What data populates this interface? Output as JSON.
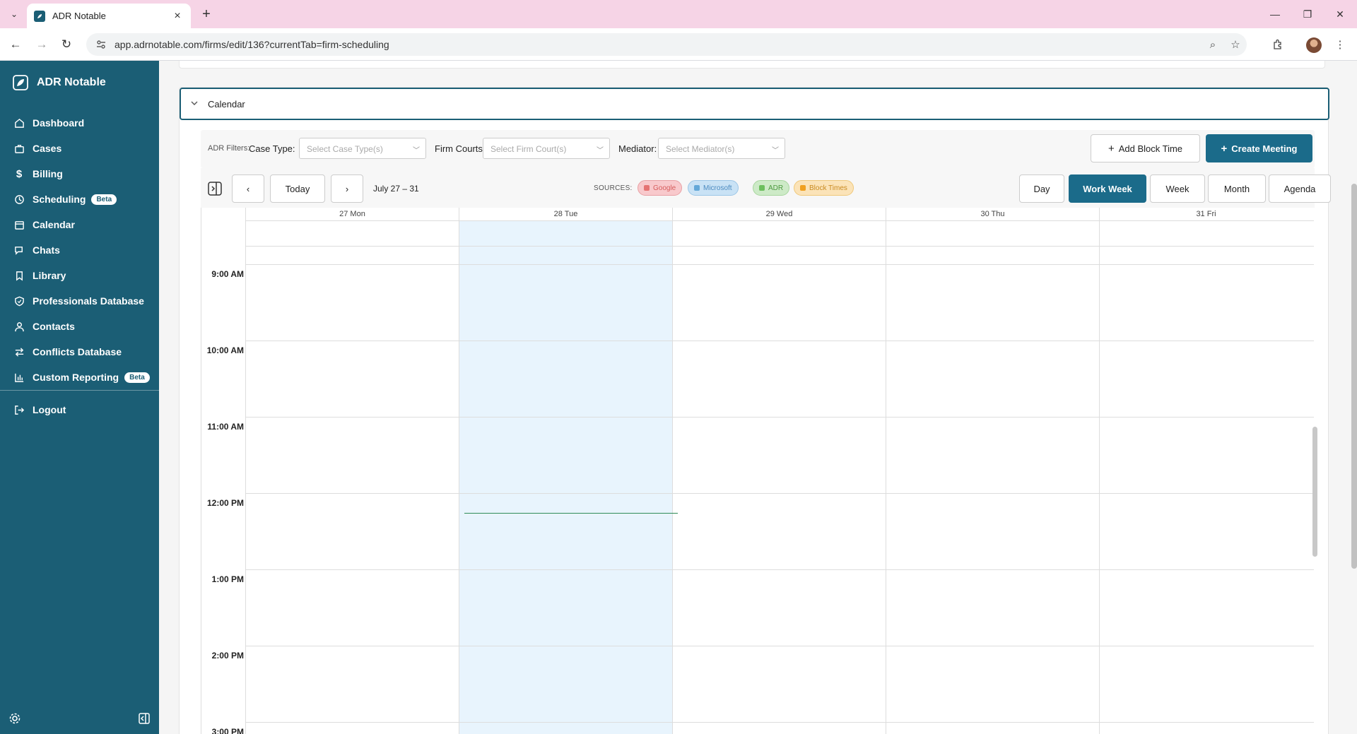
{
  "browser": {
    "tab_title": "ADR Notable",
    "url": "app.adrnotable.com/firms/edit/136?currentTab=firm-scheduling"
  },
  "sidebar": {
    "brand": "ADR Notable",
    "items": [
      {
        "label": "Dashboard",
        "icon": "home-icon"
      },
      {
        "label": "Cases",
        "icon": "briefcase-icon"
      },
      {
        "label": "Billing",
        "icon": "dollar-icon"
      },
      {
        "label": "Scheduling",
        "icon": "clock-icon",
        "badge": "Beta"
      },
      {
        "label": "Calendar",
        "icon": "calendar-icon"
      },
      {
        "label": "Chats",
        "icon": "chat-icon"
      },
      {
        "label": "Library",
        "icon": "bookmark-icon"
      },
      {
        "label": "Professionals Database",
        "icon": "shield-icon"
      },
      {
        "label": "Contacts",
        "icon": "user-icon"
      },
      {
        "label": "Conflicts Database",
        "icon": "arrows-icon"
      },
      {
        "label": "Custom Reporting",
        "icon": "bar-chart-icon",
        "badge": "Beta"
      }
    ],
    "logout": "Logout"
  },
  "panel": {
    "title": "Calendar"
  },
  "filters": {
    "label": "ADR Filters:",
    "case_type_label": "Case Type:",
    "case_type_placeholder": "Select Case Type(s)",
    "firm_courts_label": "Firm Courts:",
    "firm_courts_placeholder": "Select Firm Court(s)",
    "mediator_label": "Mediator:",
    "mediator_placeholder": "Select Mediator(s)",
    "add_block_time": "Add Block Time",
    "create_meeting": "Create Meeting"
  },
  "calendar": {
    "prev": "‹",
    "next": "›",
    "today": "Today",
    "range": "July 27 – 31",
    "sources_label": "SOURCES:",
    "sources": [
      {
        "label": "Google",
        "color": "#e57373",
        "bg": "#f8c9cc"
      },
      {
        "label": "Microsoft",
        "color": "#64a8d8",
        "bg": "#c9e2f5"
      },
      {
        "label": "ADR",
        "color": "#6cbf5e",
        "bg": "#cdeac7"
      },
      {
        "label": "Block Times",
        "color": "#f0a020",
        "bg": "#fbe3b8"
      }
    ],
    "views": [
      "Day",
      "Work Week",
      "Week",
      "Month",
      "Agenda"
    ],
    "active_view": "Work Week",
    "days": [
      "27 Mon",
      "28 Tue",
      "29 Wed",
      "30 Thu",
      "31 Fri"
    ],
    "today_day": "28 Tue",
    "times": [
      "9:00 AM",
      "10:00 AM",
      "11:00 AM",
      "12:00 PM",
      "1:00 PM",
      "2:00 PM",
      "3:00 PM"
    ]
  },
  "colors": {
    "sidebar": "#1b5e75",
    "primary": "#1b6b8a",
    "today_column": "#e8f4fd",
    "now_indicator": "#2e8b57",
    "tab_strip": "#f6d4e6"
  }
}
